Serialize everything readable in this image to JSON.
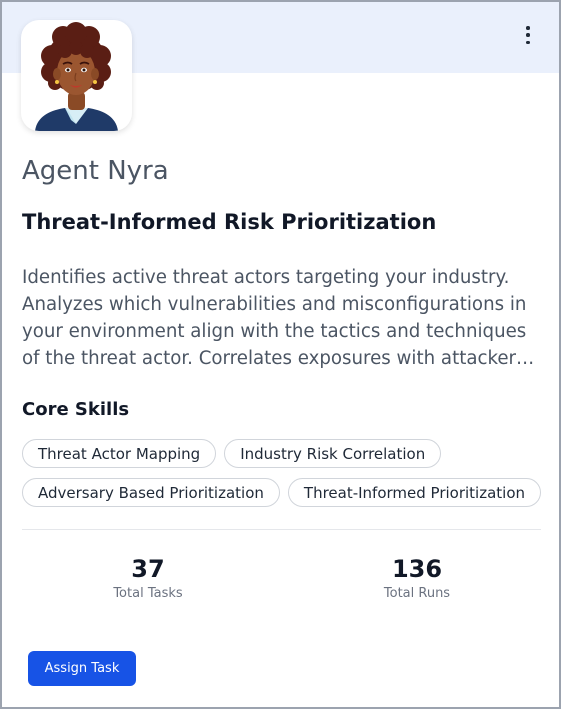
{
  "agent": {
    "name": "Agent Nyra",
    "title": "Threat-Informed Risk Prioritization",
    "description": "Identifies active threat actors targeting your industry. Analyzes which vulnerabilities and misconfigurations in your environment align with the tactics and techniques of the threat actor. Correlates exposures with attacker behavior to prioritize the risks that matter most."
  },
  "skills": {
    "heading": "Core Skills",
    "items": [
      "Threat Actor Mapping",
      "Industry Risk Correlation",
      "Adversary Based Prioritization",
      "Threat-Informed Prioritization"
    ]
  },
  "stats": {
    "tasks": {
      "value": "37",
      "label": "Total Tasks"
    },
    "runs": {
      "value": "136",
      "label": "Total Runs"
    }
  },
  "actions": {
    "assign_label": "Assign Task",
    "menu_icon": "more-vertical-icon"
  },
  "colors": {
    "banner": "#eaf0fc",
    "primary": "#1753e6",
    "border": "#9ca3af"
  }
}
